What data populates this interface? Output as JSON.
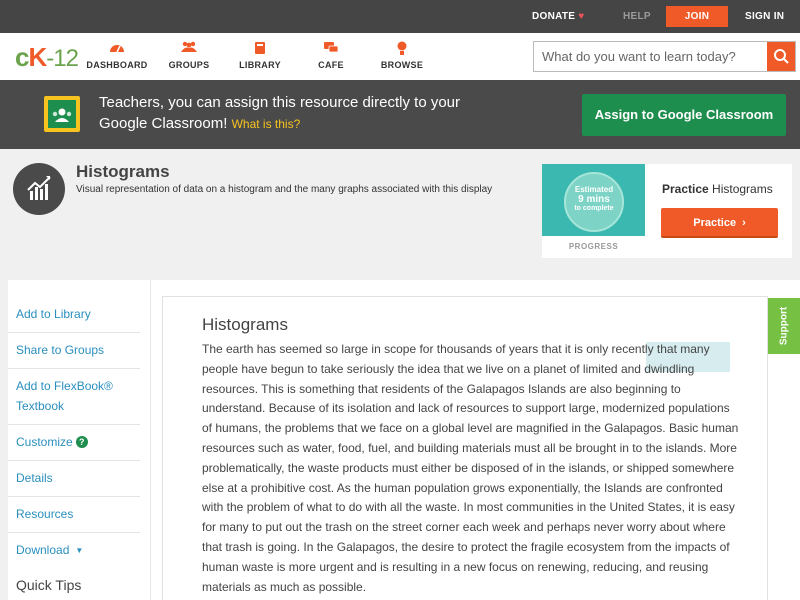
{
  "topbar": {
    "donate": "DONATE",
    "help": "HELP",
    "join": "JOIN",
    "signin": "SIGN IN"
  },
  "logo": {
    "part1": "c",
    "part2": "K",
    "part3": "-12"
  },
  "nav": {
    "items": [
      {
        "label": "DASHBOARD",
        "icon": "dashboard-icon"
      },
      {
        "label": "GROUPS",
        "icon": "groups-icon"
      },
      {
        "label": "LIBRARY",
        "icon": "library-icon"
      },
      {
        "label": "CAFE",
        "icon": "cafe-icon"
      },
      {
        "label": "BROWSE",
        "icon": "browse-icon"
      }
    ]
  },
  "search": {
    "placeholder": "What do you want to learn today?"
  },
  "classroom": {
    "message": "Teachers, you can assign this resource directly to your Google Classroom!",
    "whatis": "What is this?",
    "button": "Assign to Google Classroom"
  },
  "header": {
    "title": "Histograms",
    "description": "Visual representation of data on a histogram and the many graphs associated with this display"
  },
  "practice": {
    "estimated": "Estimated",
    "minutes": "9 mins",
    "complete": "to complete",
    "progress_label": "PROGRESS",
    "title_bold": "Practice",
    "title_rest": "Histograms",
    "button": "Practice"
  },
  "sidebar": {
    "items": [
      {
        "label": "Add to Library"
      },
      {
        "label": "Share to Groups"
      },
      {
        "label": "Add to FlexBook® Textbook"
      },
      {
        "label": "Customize"
      },
      {
        "label": "Details"
      },
      {
        "label": "Resources"
      },
      {
        "label": "Download"
      }
    ],
    "quick_tips": "Quick Tips"
  },
  "article": {
    "title": "Histograms",
    "body": "The earth has seemed so large in scope for thousands of years that it is only recently that many people have begun to take seriously the idea that we live on a planet of limited and dwindling resources. This is something that residents of the Galapagos Islands are also beginning to understand. Because of its isolation and lack of resources to support large, modernized populations of humans, the problems that we face on a global level are magnified in the Galapagos. Basic human resources such as water, food, fuel, and building materials must all be brought in to the islands. More problematically, the waste products must either be disposed of in the islands, or shipped somewhere else at a prohibitive cost. As the human population grows exponentially, the Islands are confronted with the problem of what to do with all the waste. In most communities in the United States, it is easy for many to put out the trash on the street corner each week and perhaps never worry about where that trash is going. In the Galapagos, the desire to protect the fragile ecosystem from the impacts of human waste is more urgent and is resulting in a new focus on renewing, reducing, and reusing materials as much as possible."
  },
  "support": {
    "label": "Support"
  }
}
